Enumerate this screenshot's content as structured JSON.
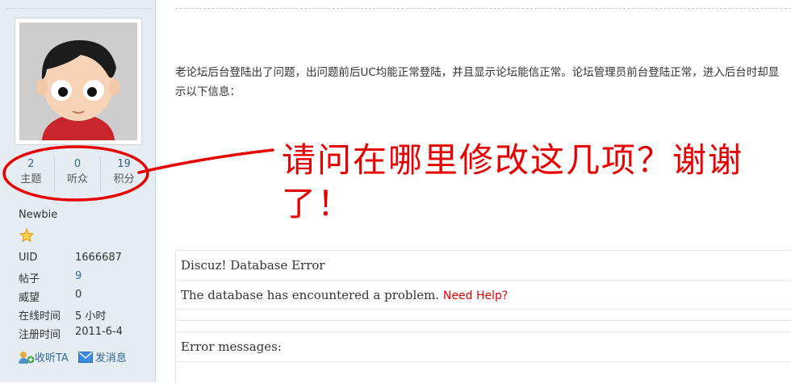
{
  "profile": {
    "stats": [
      {
        "value": "2",
        "label": "主题"
      },
      {
        "value": "0",
        "label": "听众"
      },
      {
        "value": "19",
        "label": "积分"
      }
    ],
    "group": "Newbie",
    "info": [
      {
        "label": "UID",
        "value": "1666687"
      },
      {
        "label": "帖子",
        "value": "9"
      },
      {
        "label": "威望",
        "value": "0"
      },
      {
        "label": "在线时间",
        "value": "5 小时"
      },
      {
        "label": "注册时间",
        "value": "2011-6-4"
      }
    ],
    "actions": {
      "follow": "收听TA",
      "message": "发消息"
    }
  },
  "post": {
    "text": "老论坛后台登陆出了问题，出问题前后UC均能正常登陆，并且显示论坛能信正常。论坛管理员前台登陆正常，进入后台时却显示以下信息："
  },
  "annotation": {
    "text": "请问在哪里修改这几项？谢谢了！",
    "color": "#e60000"
  },
  "error": {
    "title": "Discuz! Database Error",
    "message": "The database has encountered a problem.",
    "help_link": "Need Help?",
    "messages_label": "Error messages:"
  },
  "colors": {
    "sidebar_bg": "#e5edf2",
    "link": "#336699",
    "accent_red": "#e60000"
  }
}
